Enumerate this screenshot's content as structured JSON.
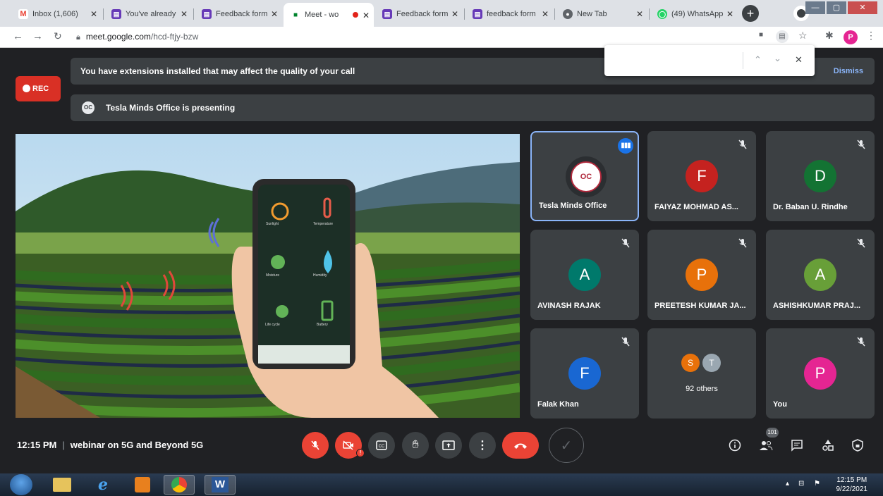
{
  "browser": {
    "tabs": [
      {
        "label": "Inbox (1,606)",
        "icon": "gmail-icon",
        "color": "#ea4335",
        "glyph": "M"
      },
      {
        "label": "You've already",
        "icon": "forms-icon",
        "color": "#673ab7",
        "glyph": "▤"
      },
      {
        "label": "Feedback form",
        "icon": "forms-icon",
        "color": "#673ab7",
        "glyph": "▤"
      },
      {
        "label": "Meet - wo",
        "icon": "meet-icon",
        "color": "#00832d",
        "glyph": "▶"
      },
      {
        "label": "Feedback form",
        "icon": "forms-icon",
        "color": "#673ab7",
        "glyph": "▤"
      },
      {
        "label": "feedback form",
        "icon": "forms-icon",
        "color": "#673ab7",
        "glyph": "▤"
      },
      {
        "label": "New Tab",
        "icon": "chrome-icon",
        "color": "#5f6368",
        "glyph": "◉"
      },
      {
        "label": "(49) WhatsApp",
        "icon": "whatsapp-icon",
        "color": "#25d366",
        "glyph": "◯"
      }
    ],
    "url_host": "meet.google.com",
    "url_path": "/hcd-ftjy-bzw",
    "profile_initial": "P"
  },
  "meet": {
    "rec_label": "REC",
    "extension_banner": "You have extensions installed that may affect the quality of your call",
    "dismiss_label": "Dismiss",
    "presenting_text": "Tesla Minds Office is presenting",
    "participants": [
      {
        "name": "Tesla Minds Office",
        "initial": "",
        "color": "#2b2e31"
      },
      {
        "name": "FAIYAZ MOHMAD AS...",
        "initial": "F",
        "color": "#c5221f"
      },
      {
        "name": "Dr. Baban U. Rindhe",
        "initial": "D",
        "color": "#137333"
      },
      {
        "name": "AVINASH RAJAK",
        "initial": "A",
        "color": "#00796b"
      },
      {
        "name": "PREETESH KUMAR JA...",
        "initial": "P",
        "color": "#e8710a"
      },
      {
        "name": "ASHISHKUMAR PRAJ...",
        "initial": "A",
        "color": "#689f38"
      },
      {
        "name": "Falak Khan",
        "initial": "F",
        "color": "#1967d2"
      },
      {
        "name": "You",
        "initial": "P",
        "color": "#e52592"
      }
    ],
    "others": {
      "label": "92 others",
      "avatars": [
        "S",
        "T"
      ]
    },
    "time": "12:15 PM",
    "meeting_name": "webinar on 5G and Beyond 5G",
    "people_count": "101"
  },
  "slide": {
    "phone_labels": [
      "Sunlight",
      "Temperature",
      "Moisture",
      "Humidity",
      "Life cycle",
      "Battery"
    ]
  },
  "taskbar": {
    "time": "12:15 PM",
    "date": "9/22/2021"
  }
}
